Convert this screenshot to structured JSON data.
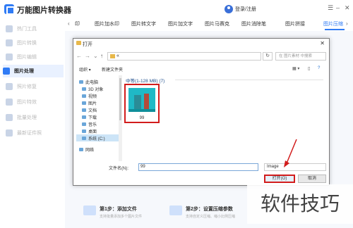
{
  "app": {
    "title": "万能图片转换器",
    "user": "登录/注册"
  },
  "sidebar": {
    "items": [
      {
        "label": "热门工具"
      },
      {
        "label": "图片转换"
      },
      {
        "label": "图片编辑"
      },
      {
        "label": "图片处理",
        "active": true
      },
      {
        "label": "照片修复"
      },
      {
        "label": "图片特效"
      },
      {
        "label": "批量处理"
      },
      {
        "label": "最新证件照"
      }
    ]
  },
  "tabs": [
    {
      "label": "印"
    },
    {
      "label": "图片加水印"
    },
    {
      "label": "图片转文字"
    },
    {
      "label": "图片加文字"
    },
    {
      "label": "图片马赛克"
    },
    {
      "label": "图片消除笔"
    },
    {
      "label": "图片拼接"
    },
    {
      "label": "图片压缩",
      "active": true
    }
  ],
  "dialog": {
    "title": "打开",
    "address": "«",
    "search_placeholder": "在 图片素材 中搜索",
    "toolbar": {
      "organize": "组织 ▾",
      "new_folder": "新建文件夹"
    },
    "nav": [
      {
        "label": "此电脑"
      },
      {
        "label": "3D 对象"
      },
      {
        "label": "视频"
      },
      {
        "label": "图片"
      },
      {
        "label": "文档"
      },
      {
        "label": "下载"
      },
      {
        "label": "音乐"
      },
      {
        "label": "桌面"
      },
      {
        "label": "系统 (C:)",
        "selected": true
      },
      {
        "label": "网络"
      }
    ],
    "group": {
      "header": "中等(1-128 MB)  (7)"
    },
    "file": {
      "name": "99"
    },
    "filename_label": "文件名(N):",
    "filename_value": "99",
    "filetype": "Image",
    "open": "打开(O)",
    "cancel": "取消"
  },
  "steps": [
    {
      "title": "第1步：添加文件",
      "sub": "支持批量添加多个图片文件"
    },
    {
      "title": "第2步：设置压缩参数",
      "sub": "支持自定义压缩、缩小比例压缩"
    }
  ],
  "watermark": "软件技巧"
}
